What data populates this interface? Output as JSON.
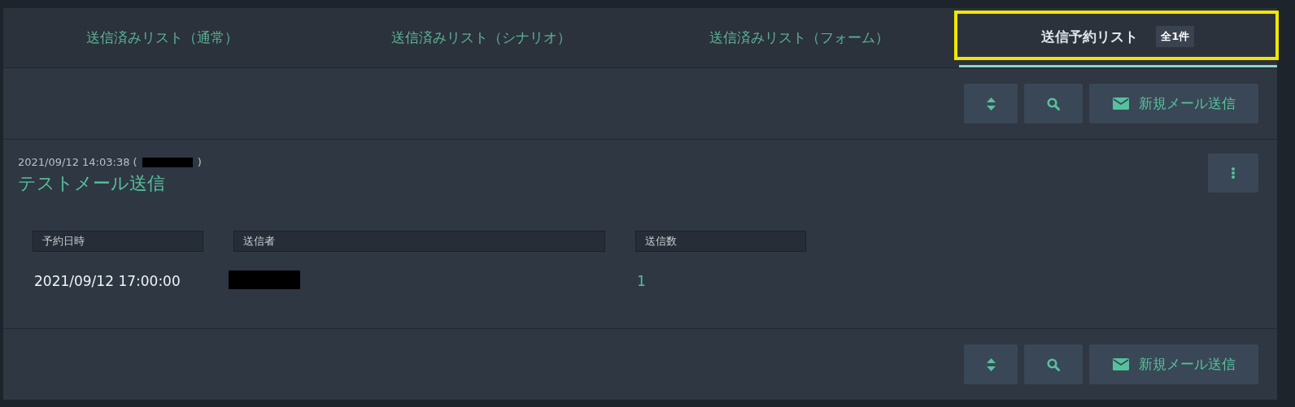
{
  "tabs": [
    {
      "label": "送信済みリスト（通常）",
      "selected": false
    },
    {
      "label": "送信済みリスト（シナリオ）",
      "selected": false
    },
    {
      "label": "送信済みリスト（フォーム）",
      "selected": false
    },
    {
      "label": "送信予約リスト",
      "selected": true,
      "badge": "全1件",
      "highlighted": true
    }
  ],
  "toolbar": {
    "compose_label": "新規メール送信"
  },
  "item": {
    "created": "2021/09/12 14:03:38 (",
    "created_end": ")",
    "title": "テストメール送信",
    "columns": [
      {
        "heading": "予約日時",
        "value": "2021/09/12 17:00:00",
        "kind": "text"
      },
      {
        "heading": "送信者",
        "kind": "redacted"
      },
      {
        "heading": "送信数",
        "value": "1",
        "kind": "count"
      }
    ]
  },
  "bottom_toolbar": {
    "compose_label": "新規メール送信"
  }
}
